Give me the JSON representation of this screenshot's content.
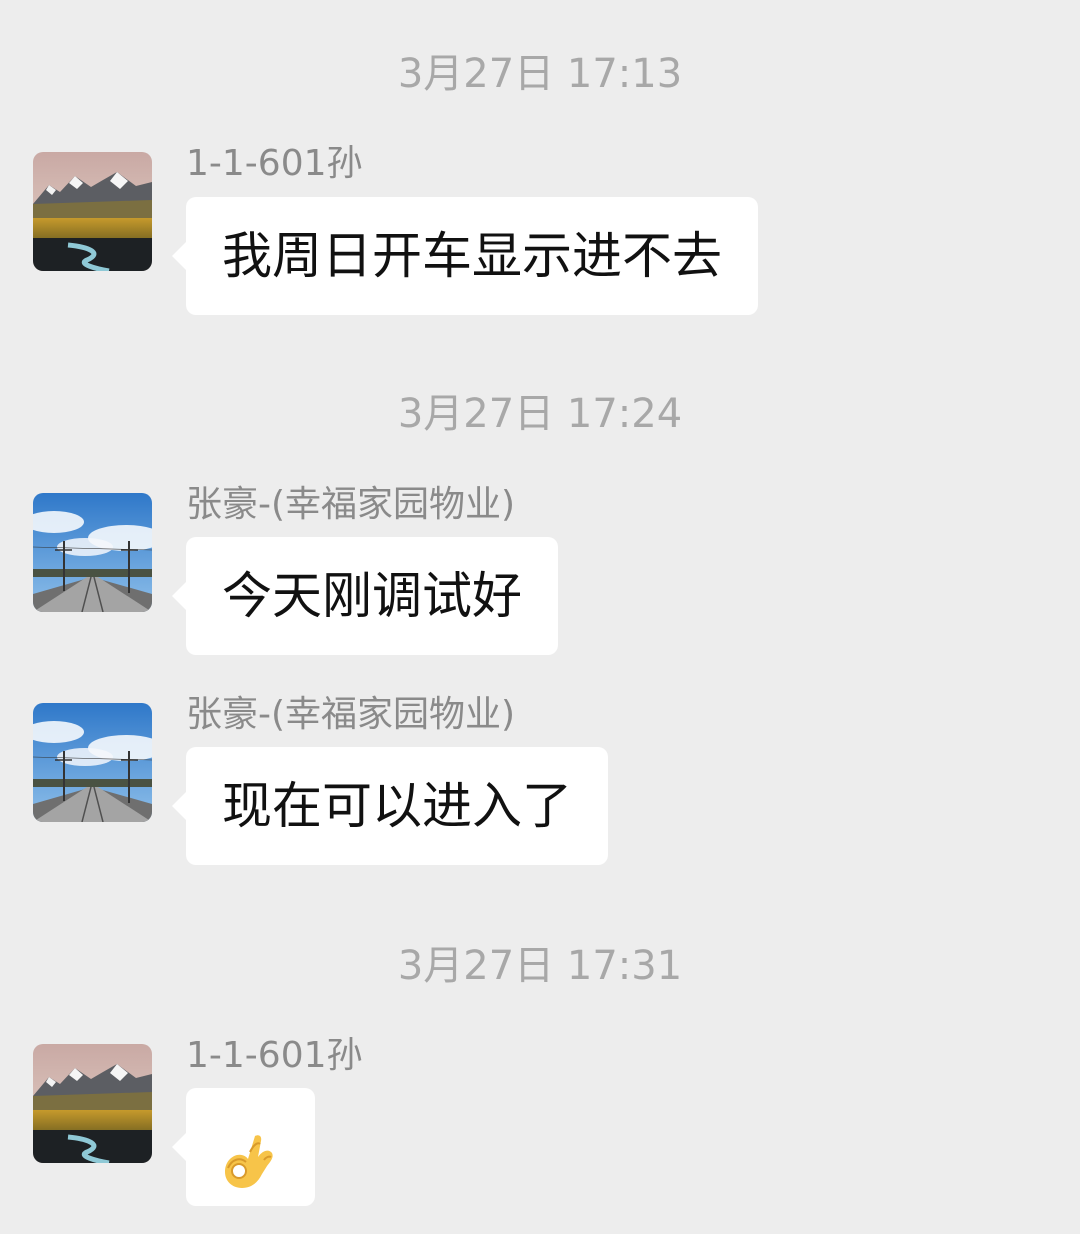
{
  "chat": {
    "messages": [
      {
        "timestamp": "3月27日 17:13",
        "sender": "1-1-601孙",
        "avatar_icon": "mountain-landscape-avatar-icon",
        "text": "我周日开车显示进不去"
      },
      {
        "timestamp": "3月27日 17:24",
        "sender": "张豪-(幸福家园物业)",
        "avatar_icon": "railway-sky-avatar-icon",
        "text": "今天刚调试好"
      },
      {
        "sender": "张豪-(幸福家园物业)",
        "avatar_icon": "railway-sky-avatar-icon",
        "text": "现在可以进入了"
      },
      {
        "timestamp": "3月27日 17:31",
        "sender": "1-1-601孙",
        "avatar_icon": "mountain-landscape-avatar-icon",
        "emoji": "ok-hand-emoji"
      }
    ]
  },
  "colors": {
    "background": "#ededed",
    "bubble": "#ffffff",
    "timestamp_text": "#a8a8a8",
    "sender_text": "#8a8a8a",
    "message_text": "#111111"
  }
}
